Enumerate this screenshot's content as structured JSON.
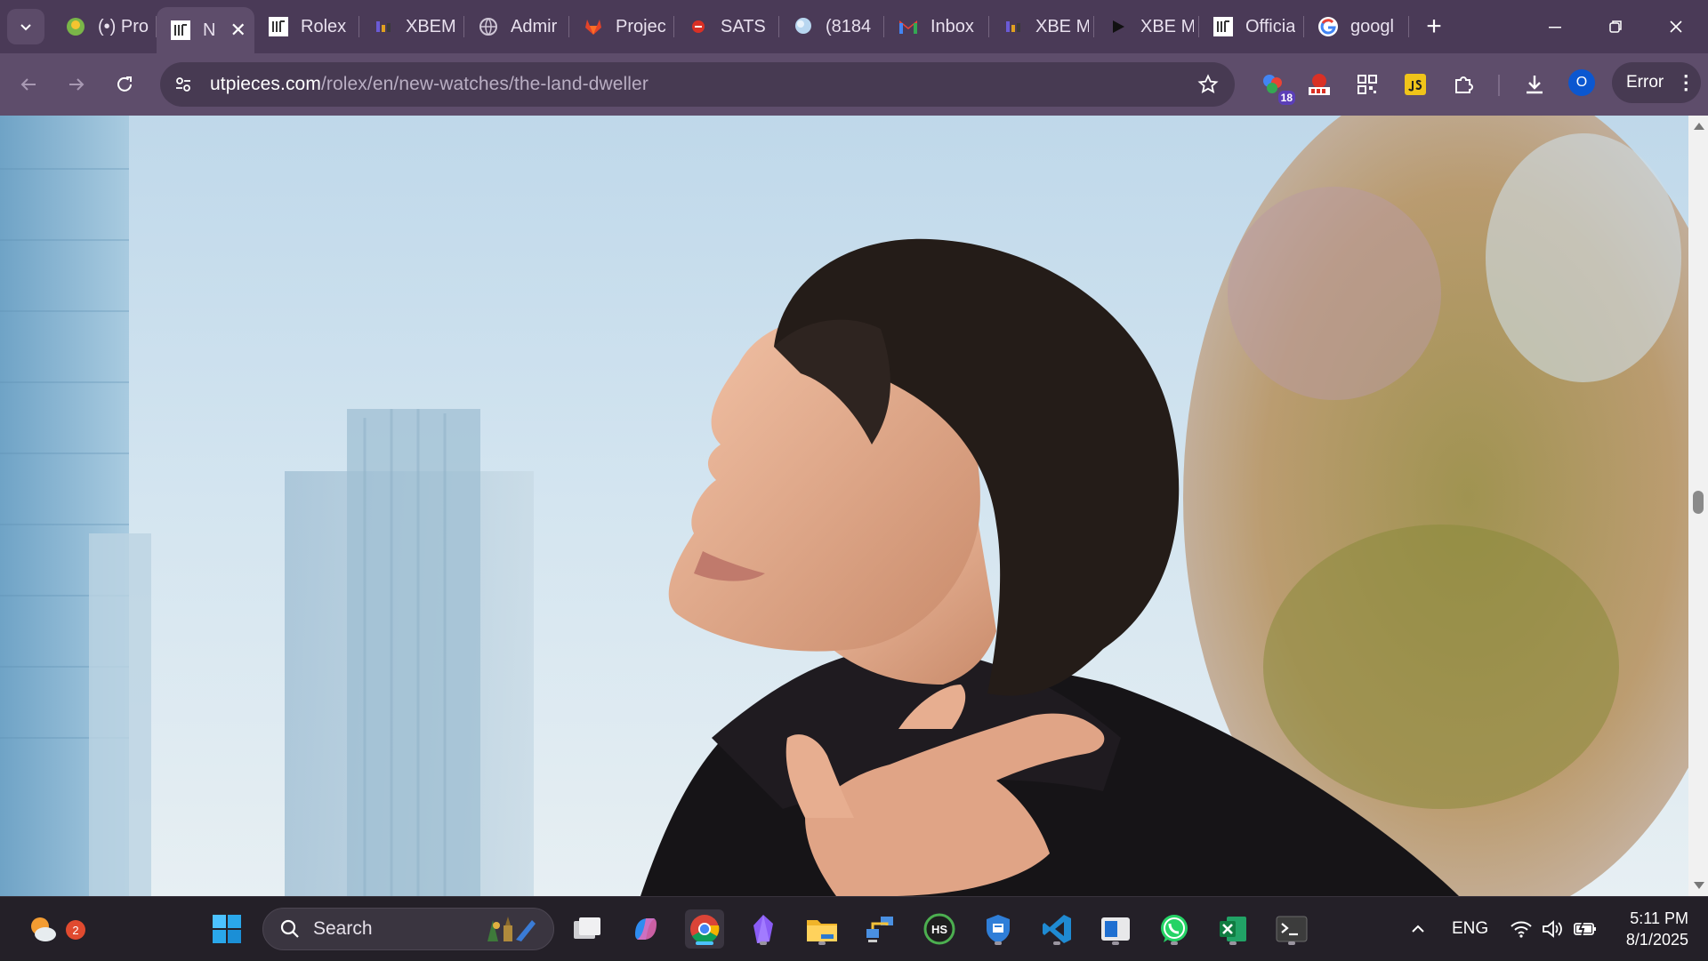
{
  "browser": {
    "tabs": [
      {
        "title": "(•) Pro",
        "icon": "green-shield-icon",
        "active": false
      },
      {
        "title": "N",
        "icon": "utp-logo-icon",
        "active": true
      },
      {
        "title": "Rolex",
        "icon": "utp-logo-icon",
        "active": false
      },
      {
        "title": "XBEM",
        "icon": "xbe-logo-icon",
        "active": false
      },
      {
        "title": "Admir",
        "icon": "globe-icon",
        "active": false
      },
      {
        "title": "Projec",
        "icon": "gitlab-icon",
        "active": false
      },
      {
        "title": "SATS",
        "icon": "red-dash-icon",
        "active": false
      },
      {
        "title": "(8184",
        "icon": "chat-bubble-icon",
        "active": false
      },
      {
        "title": "Inbox",
        "icon": "gmail-icon",
        "active": false
      },
      {
        "title": "XBE M",
        "icon": "xbe-logo-icon",
        "active": false
      },
      {
        "title": "XBE M",
        "icon": "play-icon",
        "active": false
      },
      {
        "title": "Officia",
        "icon": "utp-logo-icon",
        "active": false
      },
      {
        "title": "googl",
        "icon": "google-icon",
        "active": false
      }
    ],
    "url_host": "utpieces.com",
    "url_path": "/rolex/en/new-watches/the-land-dweller",
    "extension_badge": "18",
    "profile_initial": "O",
    "error_label": "Error"
  },
  "taskbar": {
    "weather_badge": "2",
    "search_placeholder": "Search",
    "language": "ENG",
    "time": "5:11 PM",
    "date": "8/1/2025",
    "apps": [
      "windows-start",
      "task-view",
      "copilot",
      "chrome",
      "obsidian",
      "file-explorer",
      "network-tool",
      "hubspot",
      "security-shield",
      "vscode",
      "store-app",
      "whatsapp",
      "excel",
      "terminal"
    ]
  },
  "colors": {
    "tabstrip_bg": "#4a3a57",
    "toolbar_bg": "#5e4d6b",
    "omnibox_bg": "#473a52",
    "taskbar_bg": "#242028",
    "accent_blue": "#0b57d0"
  }
}
